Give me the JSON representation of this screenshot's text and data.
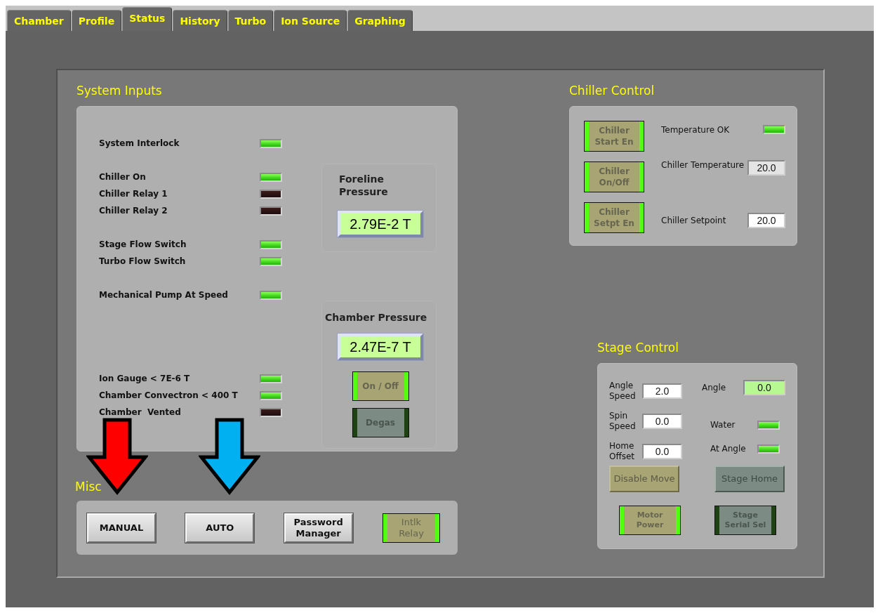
{
  "tabs": [
    {
      "label": "Chamber",
      "selected": false
    },
    {
      "label": "Profile",
      "selected": false
    },
    {
      "label": "Status",
      "selected": true
    },
    {
      "label": "History",
      "selected": false
    },
    {
      "label": "Turbo",
      "selected": false
    },
    {
      "label": "Ion Source",
      "selected": false
    },
    {
      "label": "Graphing",
      "selected": false
    }
  ],
  "system_inputs": {
    "title": "System Inputs",
    "groups": [
      {
        "items": [
          {
            "label": "System Interlock",
            "on": true
          }
        ]
      },
      {
        "items": [
          {
            "label": "Chiller On",
            "on": true
          },
          {
            "label": "Chiller Relay 1",
            "on": false
          },
          {
            "label": "Chiller Relay 2",
            "on": false
          }
        ]
      },
      {
        "items": [
          {
            "label": "Stage Flow Switch",
            "on": true
          },
          {
            "label": "Turbo Flow Switch",
            "on": true
          }
        ]
      },
      {
        "items": [
          {
            "label": "Mechanical Pump At Speed",
            "on": true
          }
        ]
      },
      {
        "items": [
          {
            "label": "Ion Gauge < 7E-6 T",
            "on": true
          },
          {
            "label": "Chamber Convectron < 400 T",
            "on": true
          },
          {
            "label": "Chamber  Vented",
            "on": false
          }
        ]
      }
    ],
    "foreline": {
      "label": "Foreline Pressure",
      "reading": "2.79E-2 T"
    },
    "chamber": {
      "label": "Chamber Pressure",
      "reading": "2.47E-7 T",
      "buttons": [
        {
          "label": "On / Off",
          "kind": "latch",
          "on": true
        },
        {
          "label": "Degas",
          "kind": "latch",
          "on": false
        }
      ]
    }
  },
  "chiller_control": {
    "title": "Chiller  Control",
    "buttons": [
      {
        "label": "Chiller Start En",
        "kind": "latch",
        "on": true
      },
      {
        "label": "Chiller On/Off",
        "kind": "latch",
        "on": true
      },
      {
        "label": "Chiller Setpt En",
        "kind": "latch",
        "on": true
      }
    ],
    "rows": [
      {
        "kind": "led",
        "label": "Temperature OK",
        "on": true
      },
      {
        "kind": "indicator",
        "label": "Chiller Temperature",
        "value": "20.0"
      },
      {
        "kind": "control",
        "label": "Chiller Setpoint",
        "value": "20.0"
      }
    ]
  },
  "stage_control": {
    "title": "Stage Control",
    "fields": [
      {
        "label": "Angle Speed",
        "value": "2.0"
      },
      {
        "label": "Spin Speed",
        "value": "0.0"
      },
      {
        "label": "Home Offset",
        "value": "0.0"
      }
    ],
    "angle": {
      "label": "Angle",
      "value": "0.0"
    },
    "leds": [
      {
        "label": "Water",
        "on": true
      },
      {
        "label": "At Angle",
        "on": true
      }
    ],
    "buttons": [
      {
        "label": "Disable Move",
        "kind": "plain",
        "on": true
      },
      {
        "label": "Stage Home",
        "kind": "plain",
        "on": false
      },
      {
        "label": "Motor Power",
        "kind": "latch",
        "on": true
      },
      {
        "label": "Stage Serial Sel",
        "kind": "latch",
        "on": false
      }
    ]
  },
  "misc": {
    "title": "Misc",
    "buttons": [
      {
        "label": "MANUAL",
        "kind": "silver"
      },
      {
        "label": "AUTO",
        "kind": "silver"
      },
      {
        "label": "Password Manager",
        "kind": "silver"
      },
      {
        "label": "Intlk Relay",
        "kind": "latch",
        "on": true
      }
    ]
  },
  "annotations": [
    {
      "kind": "arrow",
      "color": "#ff0000"
    },
    {
      "kind": "arrow",
      "color": "#00b0f0"
    }
  ]
}
